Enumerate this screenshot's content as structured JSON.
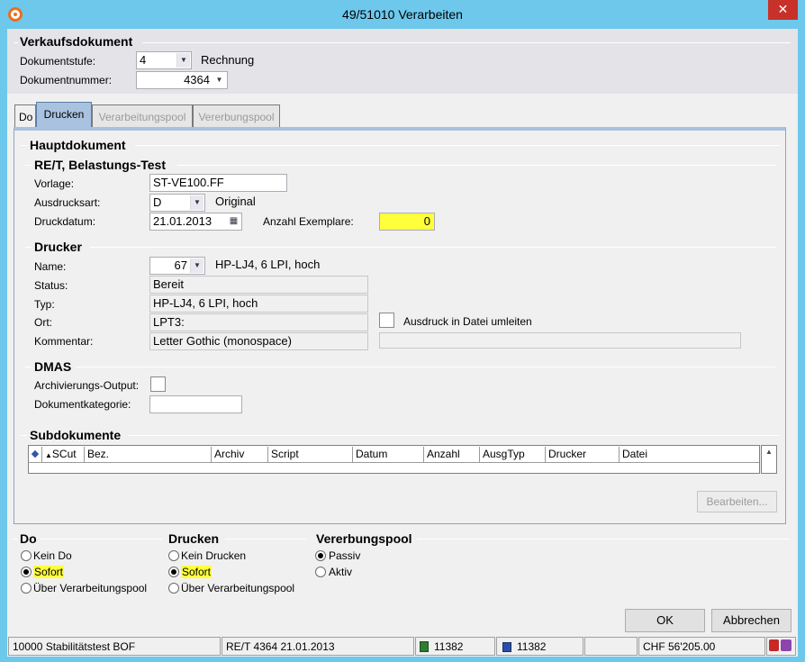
{
  "window": {
    "title": "49/51010 Verarbeiten",
    "close_glyph": "✕"
  },
  "verkaufsdokument": {
    "title": "Verkaufsdokument",
    "dokumentstufe_label": "Dokumentstufe:",
    "dokumentstufe_value": "4",
    "dokumentstufe_text": "Rechnung",
    "dokumentnummer_label": "Dokumentnummer:",
    "dokumentnummer_value": "4364"
  },
  "tabs": [
    {
      "label": "Do",
      "state": "normal"
    },
    {
      "label": "Drucken",
      "state": "active"
    },
    {
      "label": "Verarbeitungspool",
      "state": "disabled"
    },
    {
      "label": "Vererbungspool",
      "state": "disabled"
    }
  ],
  "hauptdokument": {
    "title": "Hauptdokument",
    "ret": {
      "title": "RE/T, Belastungs-Test",
      "vorlage_label": "Vorlage:",
      "vorlage_value": "ST-VE100.FF",
      "ausdrucksart_label": "Ausdrucksart:",
      "ausdrucksart_value": "D",
      "ausdrucksart_text": "Original",
      "druckdatum_label": "Druckdatum:",
      "druckdatum_value": "21.01.2013",
      "anzahl_label": "Anzahl Exemplare:",
      "anzahl_value": "0"
    },
    "drucker": {
      "title": "Drucker",
      "name_label": "Name:",
      "name_value": "67",
      "name_text": "HP-LJ4, 6 LPI, hoch",
      "status_label": "Status:",
      "status_value": "Bereit",
      "typ_label": "Typ:",
      "typ_value": "HP-LJ4, 6 LPI, hoch",
      "ort_label": "Ort:",
      "ort_value": "LPT3:",
      "datei_label": "Ausdruck in Datei umleiten",
      "kommentar_label": "Kommentar:",
      "kommentar_value": "Letter Gothic (monospace)",
      "datei_value": ""
    },
    "dmas": {
      "title": "DMAS",
      "archiv_label": "Archivierungs-Output:",
      "kategorie_label": "Dokumentkategorie:",
      "kategorie_value": ""
    }
  },
  "subdokumente": {
    "title": "Subdokumente",
    "columns": [
      "SCut",
      "Bez.",
      "Archiv",
      "Script",
      "Datum",
      "Anzahl",
      "AusgTyp",
      "Drucker",
      "Datei"
    ],
    "bearbeiten_label": "Bearbeiten..."
  },
  "options": {
    "do": {
      "title": "Do",
      "items": [
        {
          "label": "Kein Do",
          "selected": false,
          "highlight": false
        },
        {
          "label": "Sofort",
          "selected": true,
          "highlight": true
        },
        {
          "label": "Über Verarbeitungspool",
          "selected": false,
          "highlight": false
        }
      ]
    },
    "drucken": {
      "title": "Drucken",
      "items": [
        {
          "label": "Kein Drucken",
          "selected": false,
          "highlight": false
        },
        {
          "label": "Sofort",
          "selected": true,
          "highlight": true
        },
        {
          "label": "Über Verarbeitungspool",
          "selected": false,
          "highlight": false
        }
      ]
    },
    "vererbungspool": {
      "title": "Vererbungspool",
      "items": [
        {
          "label": "Passiv",
          "selected": true,
          "highlight": false
        },
        {
          "label": "Aktiv",
          "selected": false,
          "highlight": false
        }
      ]
    }
  },
  "buttons": {
    "ok": "OK",
    "abbrechen": "Abbrechen"
  },
  "statusbar": {
    "company": "10000 Stabilitätstest BOF",
    "document": "RE/T 4364  21.01.2013",
    "count1": "11382",
    "count2": "11382",
    "empty": "",
    "amount": "CHF 56'205.00"
  },
  "colors": {
    "highlight": "#ffff3c",
    "titlebar": "#6dc8ec",
    "active_tab": "#a8c2df",
    "close": "#c7312a"
  }
}
